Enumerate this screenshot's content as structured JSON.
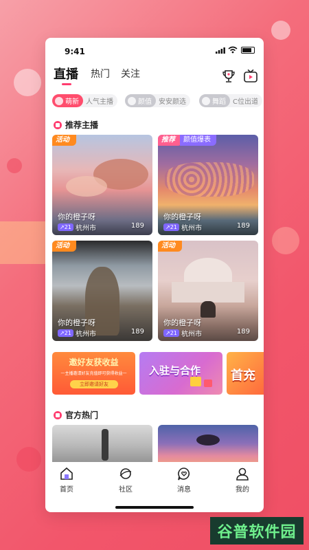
{
  "status": {
    "time": "9:41"
  },
  "tabs": [
    {
      "label": "直播",
      "active": true
    },
    {
      "label": "热门",
      "active": false
    },
    {
      "label": "关注",
      "active": false
    }
  ],
  "header_icons": [
    "trophy-icon",
    "tv-icon"
  ],
  "chips": [
    {
      "label": "萌新",
      "sub": "人气主播",
      "color": "#ff4d6d"
    },
    {
      "label": "颜值",
      "sub": "安安颜选",
      "color": "#c9c9cf"
    },
    {
      "label": "舞蹈",
      "sub": "C位出道",
      "color": "#c9c9cf"
    }
  ],
  "recommended": {
    "title": "推荐主播",
    "cards": [
      {
        "badge": "活动",
        "badge2": "",
        "title": "你的橙子呀",
        "level": "21",
        "city": "杭州市",
        "count": "189"
      },
      {
        "badge": "推荐",
        "badge2": "颜值爆表",
        "title": "你的橙子呀",
        "level": "21",
        "city": "杭州市",
        "count": "189"
      },
      {
        "badge": "活动",
        "badge2": "",
        "title": "你的橙子呀",
        "level": "21",
        "city": "杭州市",
        "count": "189"
      },
      {
        "badge": "活动",
        "badge2": "",
        "title": "你的橙子呀",
        "level": "21",
        "city": "杭州市",
        "count": "189"
      }
    ]
  },
  "banners": [
    {
      "title": "邀好友获收益",
      "sub": "一主播邀请好友充值即可获得收益一",
      "button": "立即邀请好友"
    },
    {
      "title": "入驻与合作"
    },
    {
      "title": "首充"
    }
  ],
  "official": {
    "title": "官方热门"
  },
  "nav": [
    {
      "label": "首页",
      "icon": "home-icon",
      "active": true
    },
    {
      "label": "社区",
      "icon": "planet-icon",
      "active": false
    },
    {
      "label": "消息",
      "icon": "message-heart-icon",
      "active": false
    },
    {
      "label": "我的",
      "icon": "user-icon",
      "active": false
    }
  ],
  "watermark": "谷普软件园",
  "colors": {
    "accent": "#ff3d6f",
    "activity_badge": "#ff8a1f",
    "level_badge": "#7f67ff"
  }
}
